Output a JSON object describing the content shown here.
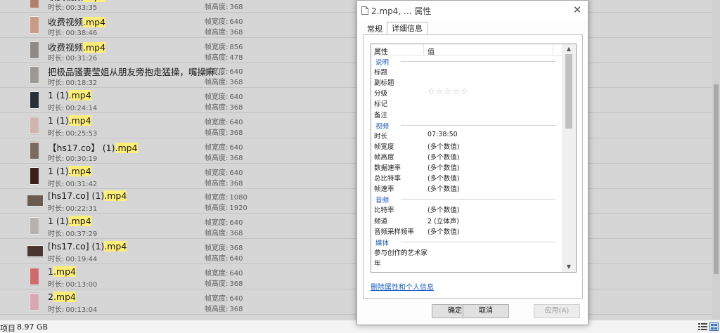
{
  "files": [
    {
      "name_plain": "收费视频",
      "name_hl": ".mp4",
      "duration": "00:33:35",
      "width": "640",
      "height": "368",
      "thumb": "#b0806a",
      "wide": false
    },
    {
      "name_plain": "收费视频",
      "name_hl": ".mp4",
      "duration": "00:38:46",
      "width": "640",
      "height": "368",
      "thumb": "#c99a86",
      "wide": false
    },
    {
      "name_plain": "收费视频",
      "name_hl": ".mp4",
      "duration": "00:31:26",
      "width": "856",
      "height": "478",
      "thumb": "#8f8a86",
      "wide": false
    },
    {
      "name_plain": "把极品骚妻莹姐从朋友旁抱走猛操，嘴操麻…",
      "name_hl": "",
      "duration": "00:18:32",
      "width": "640",
      "height": "368",
      "thumb": "#9c9994",
      "wide": false
    },
    {
      "name_plain": "1 (1)",
      "name_hl": ".mp4",
      "duration": "00:24:14",
      "width": "640",
      "height": "368",
      "thumb": "#2a2e36",
      "wide": false
    },
    {
      "name_plain": "1 (1)",
      "name_hl": ".mp4",
      "duration": "00:25:53",
      "width": "640",
      "height": "368",
      "thumb": "#d0b5ae",
      "wide": false
    },
    {
      "name_plain": "【hs17.co】 (1)",
      "name_hl": ".mp4",
      "duration": "00:30:19",
      "width": "640",
      "height": "368",
      "thumb": "#7a6a60",
      "wide": false
    },
    {
      "name_plain": "1 (1)",
      "name_hl": ".mp4",
      "duration": "00:31:42",
      "width": "640",
      "height": "368",
      "thumb": "#3a2218",
      "wide": false
    },
    {
      "name_plain": "[hs17.co] (1)",
      "name_hl": ".mp4",
      "duration": "00:22:31",
      "width": "1080",
      "height": "1920",
      "thumb": "#6b5a50",
      "wide": true
    },
    {
      "name_plain": "1 (1)",
      "name_hl": ".mp4",
      "duration": "00:37:29",
      "width": "640",
      "height": "368",
      "thumb": "#b8b2ae",
      "wide": false
    },
    {
      "name_plain": "[hs17.co] (1)",
      "name_hl": ".mp4",
      "duration": "00:19:44",
      "width": "368",
      "height": "640",
      "thumb": "#4a3530",
      "wide": true
    },
    {
      "name_plain": "1",
      "name_hl": ".mp4",
      "duration": "00:13:00",
      "width": "640",
      "height": "368",
      "thumb": "#d06a6a",
      "wide": false
    },
    {
      "name_plain": "2",
      "name_hl": ".mp4",
      "duration": "00:13:04",
      "width": "640",
      "height": "368",
      "thumb": "#d9a7b4",
      "wide": false
    }
  ],
  "labels": {
    "duration": "时长:",
    "frame_width": "帧宽度:",
    "frame_height": "帧高度:"
  },
  "statusbar": {
    "count": "项目",
    "size": "8.97 GB"
  },
  "dialog": {
    "title": "2.mp4, ... 属性",
    "tabs": [
      "常规",
      "详细信息"
    ],
    "active_tab": "详细信息",
    "header": {
      "property": "属性",
      "value": "值"
    },
    "sections": {
      "description": "说明",
      "video": "视频",
      "audio": "音频",
      "media": "媒体"
    },
    "description_rows": [
      {
        "label": "标题",
        "value": ""
      },
      {
        "label": "副标题",
        "value": ""
      },
      {
        "label": "分级",
        "value": ""
      },
      {
        "label": "标记",
        "value": ""
      },
      {
        "label": "备注",
        "value": ""
      }
    ],
    "rating_stars": "☆☆☆☆☆",
    "rating_value": 0,
    "video_rows": [
      {
        "label": "时长",
        "value": "07:38:50"
      },
      {
        "label": "帧宽度",
        "value": "(多个数值)"
      },
      {
        "label": "帧高度",
        "value": "(多个数值)"
      },
      {
        "label": "数据速率",
        "value": "(多个数值)"
      },
      {
        "label": "总比特率",
        "value": "(多个数值)"
      },
      {
        "label": "帧速率",
        "value": "(多个数值)"
      }
    ],
    "audio_rows": [
      {
        "label": "比特率",
        "value": "(多个数值)"
      },
      {
        "label": "频道",
        "value": "2 (立体声)"
      },
      {
        "label": "音频采样频率",
        "value": "(多个数值)"
      }
    ],
    "media_rows": [
      {
        "label": "参与创作的艺术家",
        "value": ""
      },
      {
        "label": "年",
        "value": ""
      }
    ],
    "remove_link": "删除属性和个人信息",
    "buttons": {
      "ok": "确定",
      "cancel": "取消",
      "apply": "应用(A)"
    }
  }
}
